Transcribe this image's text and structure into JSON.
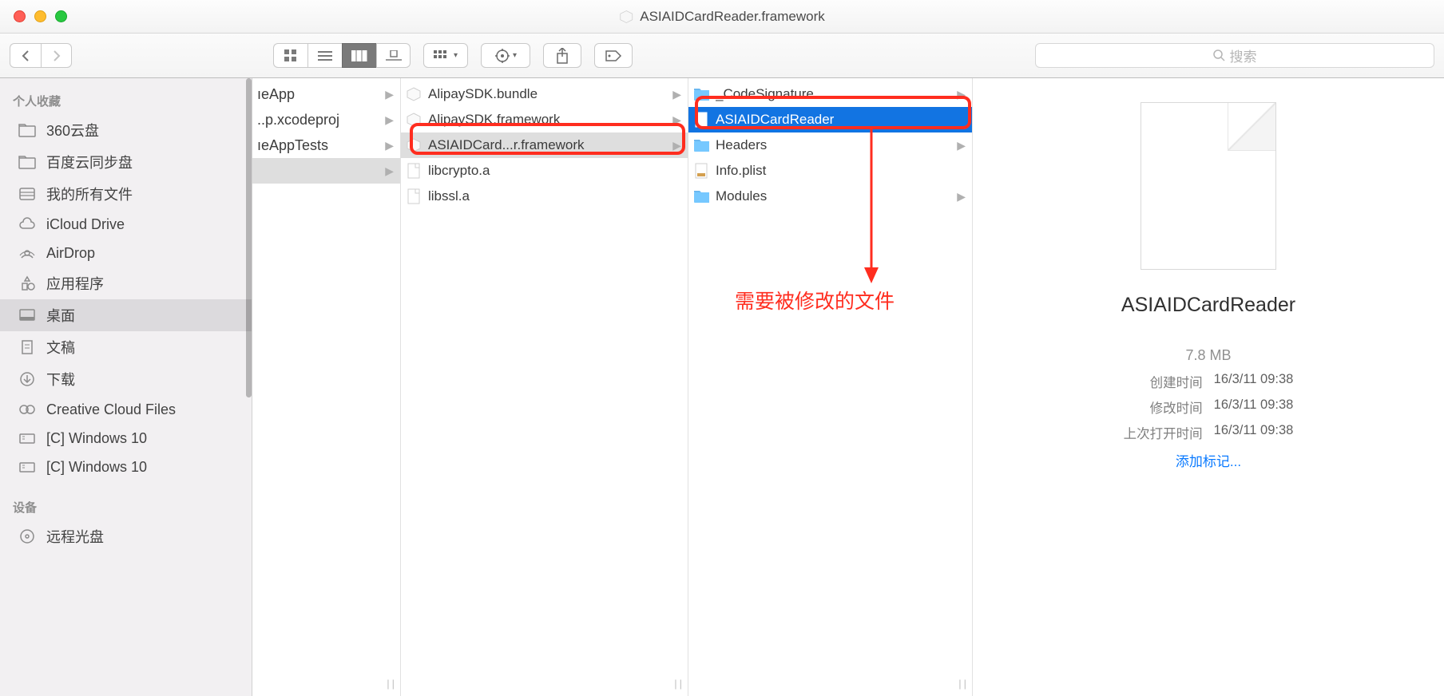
{
  "window_title": "ASIAIDCardReader.framework",
  "search_placeholder": "搜索",
  "sidebar": {
    "favorites_header": "个人收藏",
    "devices_header": "设备",
    "items": [
      {
        "label": "360云盘",
        "icon": "folder"
      },
      {
        "label": "百度云同步盘",
        "icon": "folder"
      },
      {
        "label": "我的所有文件",
        "icon": "allfiles"
      },
      {
        "label": "iCloud Drive",
        "icon": "cloud"
      },
      {
        "label": "AirDrop",
        "icon": "airdrop"
      },
      {
        "label": "应用程序",
        "icon": "apps"
      },
      {
        "label": "桌面",
        "icon": "desktop",
        "selected": true
      },
      {
        "label": "文稿",
        "icon": "docs"
      },
      {
        "label": "下载",
        "icon": "downloads"
      },
      {
        "label": "Creative Cloud Files",
        "icon": "cc"
      },
      {
        "label": "[C] Windows 10",
        "icon": "drive"
      },
      {
        "label": "[C] Windows 10",
        "icon": "drive"
      }
    ],
    "device_items": [
      {
        "label": "远程光盘",
        "icon": "disc"
      }
    ]
  },
  "col1": [
    {
      "label": "ıeApp",
      "arrow": true
    },
    {
      "label": "..p.xcodeproj",
      "arrow": true
    },
    {
      "label": "ıeAppTests",
      "arrow": true
    },
    {
      "label": "",
      "arrow": true,
      "selected": true
    }
  ],
  "col2": [
    {
      "label": "AlipaySDK.bundle",
      "icon": "fw",
      "arrow": true
    },
    {
      "label": "AlipaySDK.framework",
      "icon": "fw",
      "arrow": true
    },
    {
      "label": "ASIAIDCard...r.framework",
      "icon": "fw",
      "arrow": true,
      "selected": true
    },
    {
      "label": "libcrypto.a",
      "icon": "file"
    },
    {
      "label": "libssl.a",
      "icon": "file"
    }
  ],
  "col3": [
    {
      "label": "_CodeSignature",
      "icon": "folder",
      "arrow": true
    },
    {
      "label": "ASIAIDCardReader",
      "icon": "exec",
      "selected": true,
      "blue": true
    },
    {
      "label": "Headers",
      "icon": "folder",
      "arrow": true
    },
    {
      "label": "Info.plist",
      "icon": "plist"
    },
    {
      "label": "Modules",
      "icon": "folder",
      "arrow": true
    }
  ],
  "preview": {
    "name": "ASIAIDCardReader",
    "size": "7.8 MB",
    "created_label": "创建时间",
    "created": "16/3/11 09:38",
    "modified_label": "修改时间",
    "modified": "16/3/11 09:38",
    "opened_label": "上次打开时间",
    "opened": "16/3/11 09:38",
    "tags": "添加标记..."
  },
  "annotation_text": "需要被修改的文件"
}
